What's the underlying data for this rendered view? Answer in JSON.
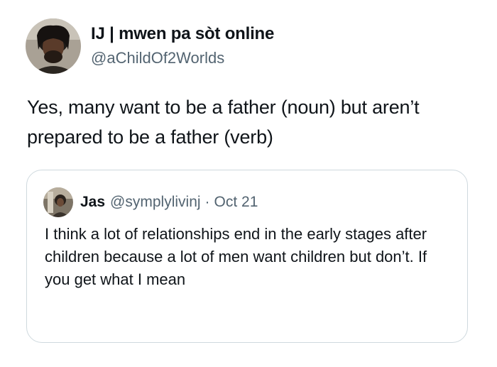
{
  "author": {
    "display_name": "IJ | mwen pa sòt online",
    "handle": "@aChildOf2Worlds",
    "avatar_icon": "profile-photo-avatar"
  },
  "tweet": {
    "text": "Yes, many want to be a father (noun) but aren’t prepared to be a father (verb)"
  },
  "quoted_tweet": {
    "display_name": "Jas",
    "handle": "@symplylivinj",
    "separator": "·",
    "date": "Oct 21",
    "avatar_icon": "profile-photo-avatar",
    "text": "I think a lot of relationships end in the early stages after children because a lot of men want children but don’t. If you get what I mean"
  },
  "colors": {
    "text_primary": "#0f1419",
    "text_secondary": "#536471",
    "border": "#cfd9de",
    "background": "#ffffff"
  }
}
